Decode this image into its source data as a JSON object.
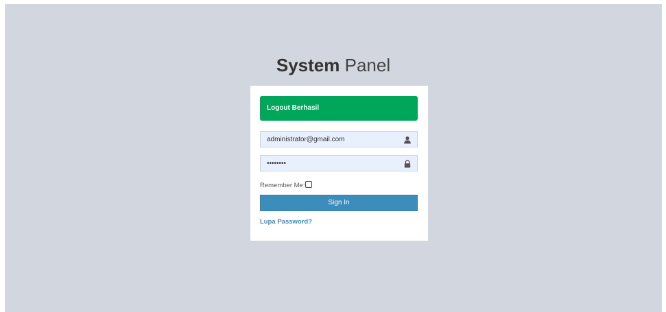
{
  "logo": {
    "bold": "System",
    "light": "Panel"
  },
  "alert": {
    "message": "Logout Berhasil"
  },
  "login": {
    "email_value": "administrator@gmail.com",
    "password_value": "12345678",
    "remember_label": "Remember Me:",
    "remember_checked": false,
    "signin_label": "Sign In",
    "forgot_label": "Lupa Password?"
  },
  "icons": {
    "email": "user-icon",
    "password": "lock-icon"
  },
  "colors": {
    "background": "#d2d6de",
    "alert": "#00a65a",
    "primary": "#3c8dbc",
    "input_bg": "#e8f0fe"
  }
}
